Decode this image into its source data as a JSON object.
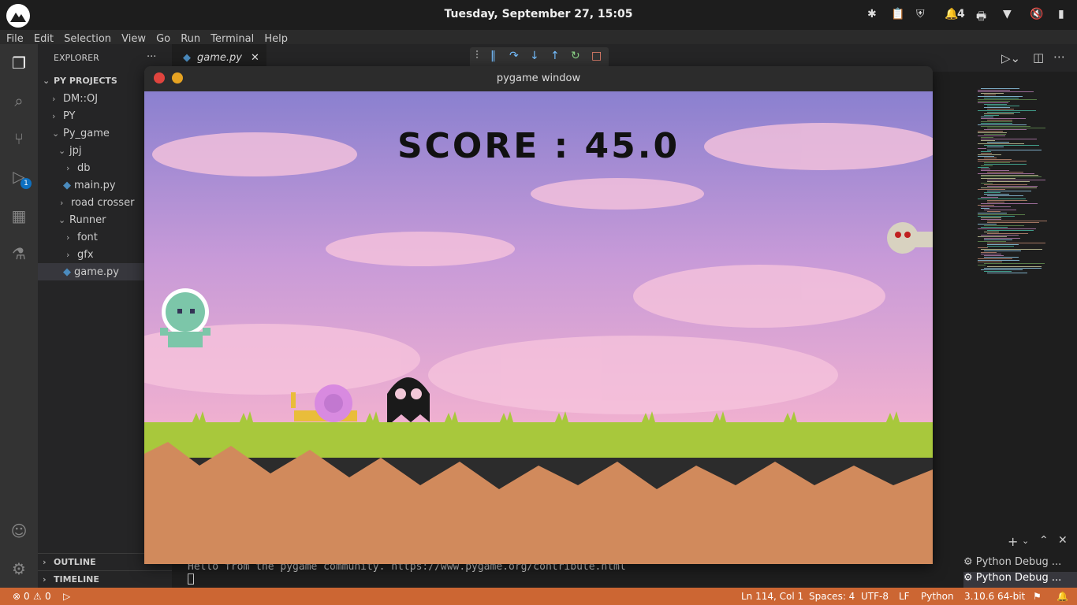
{
  "system": {
    "clock": "Tuesday, September 27, 15:05",
    "notif_count": "4"
  },
  "menu": [
    "File",
    "Edit",
    "Selection",
    "View",
    "Go",
    "Run",
    "Terminal",
    "Help"
  ],
  "sidebar": {
    "header": "EXPLORER",
    "more": "···",
    "root": "PY PROJECTS",
    "items": [
      {
        "label": "DM::OJ",
        "chev": "›"
      },
      {
        "label": "PY",
        "chev": "›"
      },
      {
        "label": "Py_game",
        "chev": "⌄"
      },
      {
        "label": "jpj",
        "chev": "⌄"
      },
      {
        "label": "db",
        "chev": "›"
      },
      {
        "label": "main.py",
        "chev": ""
      },
      {
        "label": "road crosser",
        "chev": "›"
      },
      {
        "label": "Runner",
        "chev": "⌄"
      },
      {
        "label": "font",
        "chev": "›"
      },
      {
        "label": "gfx",
        "chev": "›"
      },
      {
        "label": "game.py",
        "chev": ""
      }
    ],
    "outline": "OUTLINE",
    "timeline": "TIMELINE"
  },
  "tabs": {
    "active": "game.py",
    "close": "✕"
  },
  "debug_badge": "1",
  "pygame": {
    "window_title": "pygame window",
    "score_label": "SCORE : 45.0"
  },
  "terminal": {
    "line": "Hello from the pygame community. https://www.pygame.org/contribute.html",
    "sessions": [
      "Python Debug ...",
      "Python Debug ..."
    ]
  },
  "status": {
    "errors": "0",
    "warnings": "0",
    "position": "Ln 114, Col 1",
    "spaces": "Spaces: 4",
    "encoding": "UTF-8",
    "eol": "LF",
    "language": "Python",
    "interpreter": "3.10.6 64-bit"
  },
  "colors": {
    "statusbar": "#cc6633",
    "grass": "#a8c83c",
    "dirt": "#d18a5c",
    "sky_top": "#8a80cf",
    "sky_bottom": "#f0b0d0"
  }
}
